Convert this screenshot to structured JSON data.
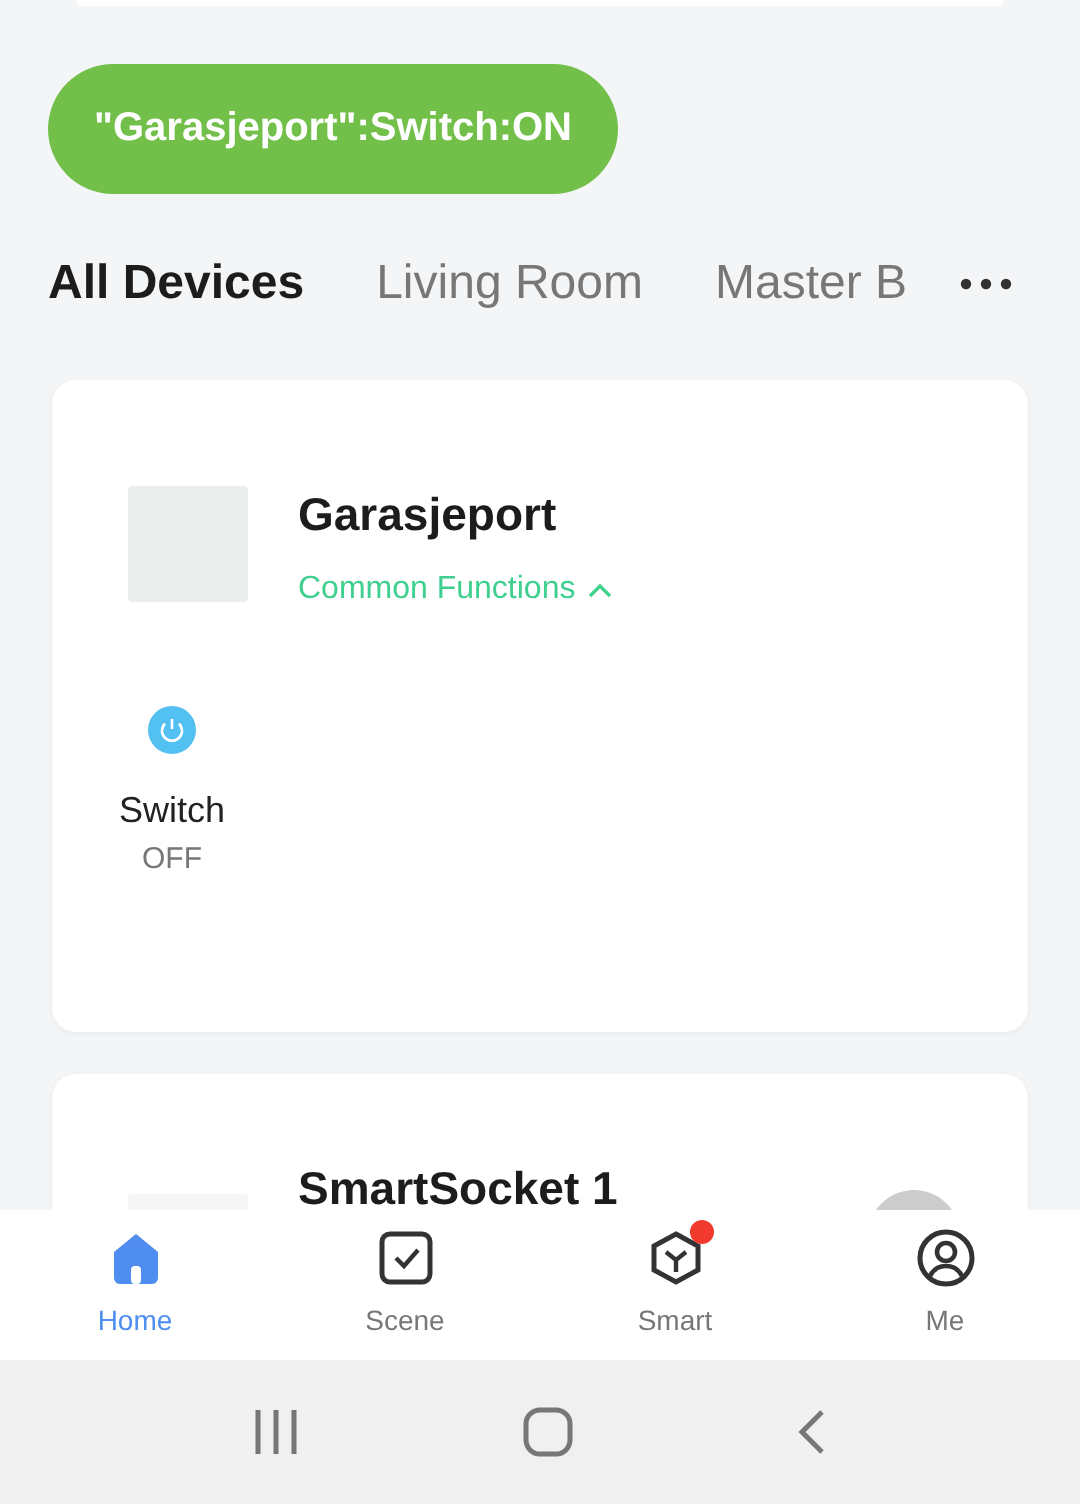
{
  "toast": {
    "text": "\"Garasjeport\":Switch:ON"
  },
  "tabs": [
    {
      "label": "All Devices",
      "selected": true
    },
    {
      "label": "Living Room",
      "selected": false
    },
    {
      "label": "Master B",
      "selected": false
    }
  ],
  "devices": [
    {
      "name": "Garasjeport",
      "functions": {
        "label": "Common Functions",
        "expanded": true
      },
      "controls": [
        {
          "label": "Switch",
          "value": "OFF"
        }
      ]
    },
    {
      "name": "SmartSocket 1"
    }
  ],
  "bottom_nav": [
    {
      "label": "Home",
      "selected": true,
      "notification": false
    },
    {
      "label": "Scene",
      "selected": false,
      "notification": false
    },
    {
      "label": "Smart",
      "selected": false,
      "notification": true
    },
    {
      "label": "Me",
      "selected": false,
      "notification": false
    }
  ]
}
